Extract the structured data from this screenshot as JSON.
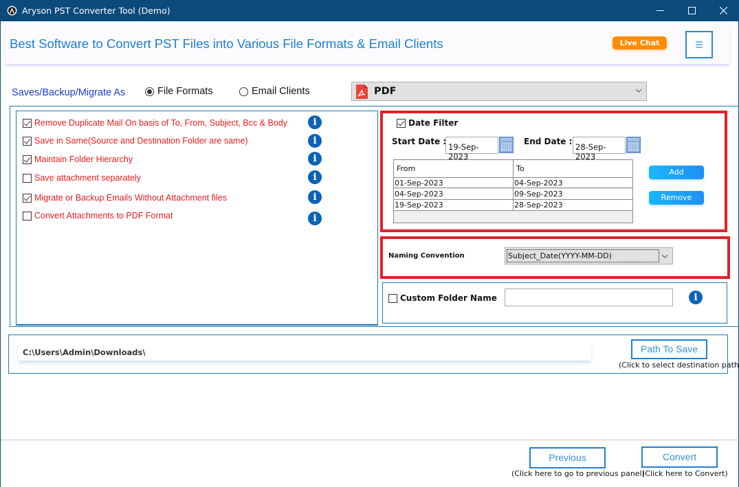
{
  "window": {
    "title": "Aryson PST Converter Tool (Demo)"
  },
  "banner": {
    "headline": "Best Software to Convert PST Files into Various File Formats & Email Clients",
    "live_chat_label": "Live Chat",
    "menu_icon": "hamburger-icon"
  },
  "saves": {
    "label": "Saves/Backup/Migrate As",
    "options": [
      {
        "label": "File Formats",
        "selected": true
      },
      {
        "label": "Email Clients",
        "selected": false
      }
    ],
    "format_selected": "PDF",
    "format_icon": "pdf-file-icon"
  },
  "options": [
    {
      "label": "Remove Duplicate Mail On basis of To, From, Subject, Bcc & Body",
      "checked": true
    },
    {
      "label": "Save in Same(Source and Destination Folder are same)",
      "checked": true
    },
    {
      "label": "Maintain Folder Hierarchy",
      "checked": true
    },
    {
      "label": "Save attachment separately",
      "checked": false
    },
    {
      "label": "Migrate or Backup Emails Without Attachment files",
      "checked": true
    },
    {
      "label": "Convert Attachments to PDF Format",
      "checked": false
    }
  ],
  "date_filter": {
    "label": "Date Filter",
    "checked": true,
    "start_label": "Start Date :",
    "start_value": "19-Sep-2023",
    "end_label": "End Date :",
    "end_value": "28-Sep-2023",
    "columns": [
      "From",
      "To"
    ],
    "rows": [
      [
        "01-Sep-2023",
        "04-Sep-2023"
      ],
      [
        "04-Sep-2023",
        "09-Sep-2023"
      ],
      [
        "19-Sep-2023",
        "28-Sep-2023"
      ]
    ],
    "add_label": "Add",
    "remove_label": "Remove"
  },
  "naming": {
    "label": "Naming Convention",
    "selected": "Subject_Date(YYYY-MM-DD)"
  },
  "custom_folder": {
    "label": "Custom Folder Name",
    "checked": false,
    "value": ""
  },
  "path": {
    "value": "C:\\Users\\Admin\\Downloads\\",
    "button_label": "Path To Save",
    "hint": "(Click to select destination path)"
  },
  "footer": {
    "previous_label": "Previous",
    "previous_hint": "(Click here to go to previous panel)",
    "convert_label": "Convert",
    "convert_hint": "(Click here to Convert)"
  },
  "colors": {
    "titlebar": "#0b4a7b",
    "headline": "#1e7fd1",
    "live_chat": "#ff8c00",
    "option_text": "#e81c1c",
    "highlight_box": "#e32028",
    "panel_border": "#1a7bb0"
  }
}
